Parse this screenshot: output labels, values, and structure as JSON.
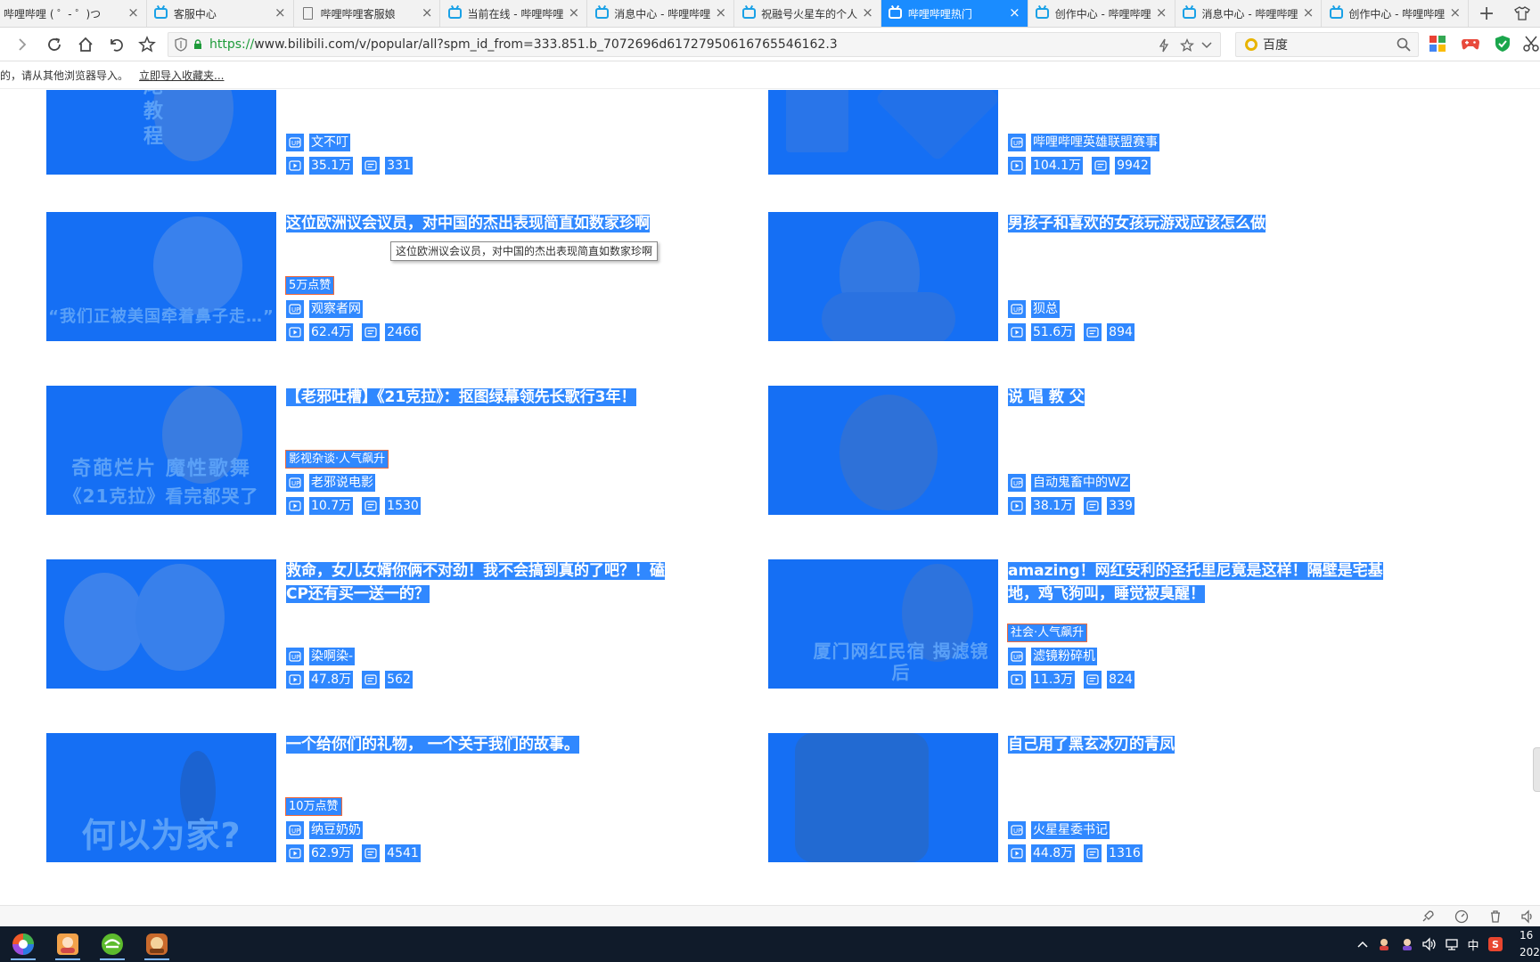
{
  "tabs": [
    {
      "title": "哔哩哔哩 ( ゜- ゜)つ",
      "icon": "none",
      "active": false
    },
    {
      "title": "客服中心",
      "icon": "bilibili-tv-icon",
      "active": false
    },
    {
      "title": "哔哩哔哩客服娘",
      "icon": "document-icon",
      "active": false
    },
    {
      "title": "当前在线 - 哔哩哔哩",
      "icon": "bilibili-tv-icon",
      "active": false
    },
    {
      "title": "消息中心 - 哔哩哔哩",
      "icon": "bilibili-tv-icon",
      "active": false
    },
    {
      "title": "祝融号火星车的个人",
      "icon": "bilibili-tv-icon",
      "active": false
    },
    {
      "title": "哔哩哔哩热门",
      "icon": "bilibili-tv-icon",
      "active": true
    },
    {
      "title": "创作中心 - 哔哩哔哩",
      "icon": "bilibili-tv-icon",
      "active": false
    },
    {
      "title": "消息中心 - 哔哩哔哩",
      "icon": "bilibili-tv-icon",
      "active": false
    },
    {
      "title": "创作中心 - 哔哩哔哩",
      "icon": "bilibili-tv-icon",
      "active": false
    }
  ],
  "tab_close_glyph": "×",
  "new_tab_glyph": "+",
  "address": {
    "scheme": "https://",
    "rest": "www.bilibili.com/v/popular/all?spm_id_from=333.851.b_7072696d61727950616765546162.3"
  },
  "search": {
    "engine": "百度"
  },
  "notice": {
    "text": "的，请从其他浏览器导入。",
    "link": "立即导入收藏夹..."
  },
  "videos": [
    {
      "title": "",
      "tag": "",
      "up": "文不叮",
      "plays": "35.1万",
      "danmaku": "331",
      "thumb_text": "尾 教 程"
    },
    {
      "title": "",
      "tag": "",
      "up": "哔哩哔哩英雄联盟赛事",
      "plays": "104.1万",
      "danmaku": "9942",
      "thumb_text": ""
    },
    {
      "title": "这位欧洲议会议员，对中国的杰出表现简直如数家珍啊",
      "tag": "5万点赞",
      "up": "观察者网",
      "plays": "62.4万",
      "danmaku": "2466",
      "thumb_text": "“我们正被美国牵着鼻子走…”"
    },
    {
      "title": "男孩子和喜欢的女孩玩游戏应该怎么做",
      "tag": "",
      "up": "狈总",
      "plays": "51.6万",
      "danmaku": "894",
      "thumb_text": ""
    },
    {
      "title": "【老邪吐槽】《21克拉》：抠图绿幕领先长歌行3年！",
      "tag": "影视杂谈·人气飙升",
      "up": "老邪说电影",
      "plays": "10.7万",
      "danmaku": "1530",
      "thumb_text": "《21克拉》看完都哭了"
    },
    {
      "title": "说 唱 教 父",
      "tag": "",
      "up": "自动鬼畜中的WZ",
      "plays": "38.1万",
      "danmaku": "339",
      "thumb_text": ""
    },
    {
      "title": "救命，女儿女婿你俩不对劲！我不会搞到真的了吧？！磕CP还有买一送一的？",
      "tag": "",
      "up": "染啊染-",
      "plays": "47.8万",
      "danmaku": "562",
      "thumb_text": ""
    },
    {
      "title": "amazing！网红安利的圣托里尼竟是这样！隔壁是宅基地，鸡飞狗叫，睡觉被臭醒！",
      "tag": "社会·人气飙升",
      "up": "滤镜粉碎机",
      "plays": "11.3万",
      "danmaku": "824",
      "thumb_text": "厦门网红民宿 揭滤镜后"
    },
    {
      "title": "一个给你们的礼物， 一个关于我们的故事。",
      "tag": "10万点赞",
      "up": "纳豆奶奶",
      "plays": "62.9万",
      "danmaku": "4541",
      "thumb_text": "何以为家?"
    },
    {
      "title": "自己用了黑玄冰刃的青凤",
      "tag": "",
      "up": "火星星委书记",
      "plays": "44.8万",
      "danmaku": "1316",
      "thumb_text": ""
    }
  ],
  "tooltip": "这位欧洲议会议员，对中国的杰出表现简直如数家珍啊",
  "thumb_extra_text": {
    "sub": "奇葩烂片 魔性歌舞"
  },
  "taskbar": {
    "clock": "16",
    "date_prefix": "202",
    "ime": "中"
  },
  "colors": {
    "selection": "#3088ff",
    "thumb_overlay": "#0066ff",
    "active_tab": "#1a8cff",
    "taskbar": "#101b2a",
    "url_scheme": "#1e9b3a"
  }
}
